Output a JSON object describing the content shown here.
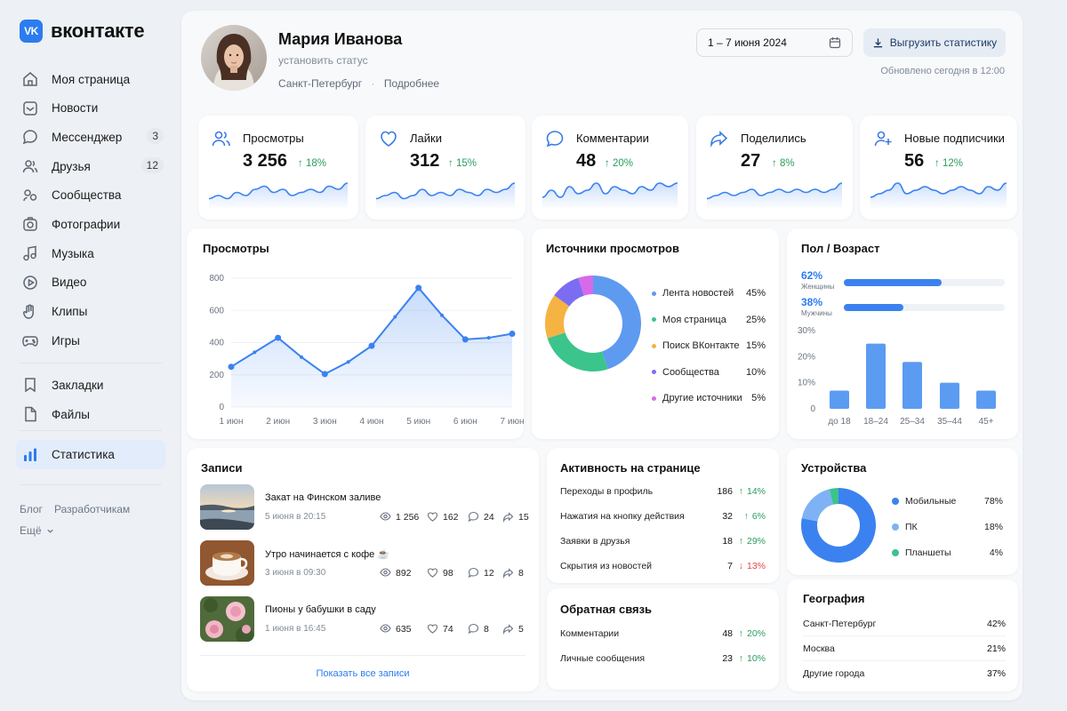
{
  "brand": {
    "logo_mark": "VK",
    "name": "вконтакте"
  },
  "sidebar": {
    "items": [
      {
        "label": "Моя страница",
        "icon": "home-icon"
      },
      {
        "label": "Новости",
        "icon": "news-icon"
      },
      {
        "label": "Мессенджер",
        "icon": "chat-icon",
        "badge": "3"
      },
      {
        "label": "Друзья",
        "icon": "friends-icon",
        "badge": "12"
      },
      {
        "label": "Сообщества",
        "icon": "communities-icon"
      },
      {
        "label": "Фотографии",
        "icon": "camera-icon"
      },
      {
        "label": "Музыка",
        "icon": "music-icon"
      },
      {
        "label": "Видео",
        "icon": "video-icon"
      },
      {
        "label": "Клипы",
        "icon": "clips-icon"
      },
      {
        "label": "Игры",
        "icon": "gamepad-icon"
      }
    ],
    "secondary": [
      {
        "label": "Закладки",
        "icon": "bookmark-icon"
      },
      {
        "label": "Файлы",
        "icon": "file-icon"
      }
    ],
    "active": {
      "label": "Статистика",
      "icon": "stats-icon"
    },
    "footer": {
      "blog": "Блог",
      "dev": "Разработчикам",
      "more": "Ещё"
    }
  },
  "profile": {
    "name": "Мария Иванова",
    "status": "установить статус",
    "city": "Санкт-Петербург",
    "dot": "·",
    "more": "Подробнее"
  },
  "toolbar": {
    "date_range": "1 – 7 июня 2024",
    "export_label": "Выгрузить статистику",
    "updated": "Обновлено сегодня в 12:00"
  },
  "metrics": [
    {
      "label": "Просмотры",
      "value": "3 256",
      "delta": "18%",
      "icon": "users-icon",
      "spark": [
        3,
        4,
        3,
        5,
        4,
        6,
        7,
        5,
        6,
        4,
        5,
        6,
        5,
        7,
        6,
        8
      ]
    },
    {
      "label": "Лайки",
      "value": "312",
      "delta": "15%",
      "icon": "heart-icon",
      "spark": [
        3,
        4,
        5,
        3,
        4,
        6,
        4,
        5,
        4,
        6,
        5,
        4,
        6,
        5,
        6,
        8
      ]
    },
    {
      "label": "Комментарии",
      "value": "48",
      "delta": "20%",
      "icon": "comment-icon",
      "spark": [
        3,
        5,
        3,
        6,
        4,
        5,
        7,
        4,
        6,
        5,
        4,
        6,
        5,
        7,
        6,
        7
      ]
    },
    {
      "label": "Поделились",
      "value": "27",
      "delta": "8%",
      "icon": "share-icon",
      "spark": [
        3,
        4,
        5,
        4,
        5,
        6,
        4,
        5,
        6,
        5,
        6,
        5,
        6,
        5,
        6,
        8
      ]
    },
    {
      "label": "Новые подписчики",
      "value": "56",
      "delta": "12%",
      "icon": "user-plus-icon",
      "spark": [
        3,
        4,
        5,
        7,
        4,
        5,
        6,
        5,
        4,
        5,
        6,
        5,
        4,
        6,
        5,
        7
      ]
    }
  ],
  "arrow_up": "↑",
  "arrow_down": "↓",
  "views_chart": {
    "title": "Просмотры"
  },
  "sources": {
    "title": "Источники просмотров",
    "items": [
      {
        "label": "Лента новостей",
        "pct": "45%",
        "value": 45,
        "color": "#5e9af0"
      },
      {
        "label": "Моя страница",
        "pct": "25%",
        "value": 25,
        "color": "#3bc48c"
      },
      {
        "label": "Поиск ВКонтакте",
        "pct": "15%",
        "value": 15,
        "color": "#f5b342"
      },
      {
        "label": "Сообщества",
        "pct": "10%",
        "value": 10,
        "color": "#7b6df2"
      },
      {
        "label": "Другие источники",
        "pct": "5%",
        "value": 5,
        "color": "#d76ae8"
      }
    ]
  },
  "demographics": {
    "title": "Пол / Возраст",
    "female_pct": "62%",
    "female_label": "Женщины",
    "female_value": 0.62,
    "male_pct": "38%",
    "male_label": "Мужчины",
    "male_value": 0.38
  },
  "chart_data": [
    {
      "type": "area",
      "title": "Просмотры",
      "categories": [
        "1 июн",
        "2 июн",
        "3 июн",
        "4 июн",
        "5 июн",
        "6 июн",
        "7 июн"
      ],
      "x": [
        1,
        1.5,
        2,
        2.5,
        3,
        3.5,
        4,
        4.5,
        5,
        5.5,
        6,
        6.5,
        7
      ],
      "values": [
        250,
        340,
        430,
        310,
        205,
        280,
        380,
        560,
        740,
        570,
        420,
        430,
        455
      ],
      "ylim": [
        0,
        800
      ],
      "yticks": [
        "0",
        "200",
        "400",
        "600",
        "800"
      ],
      "grid": "horizontal"
    },
    {
      "type": "bar",
      "title": "Пол / Возраст",
      "categories": [
        "до 18",
        "18–24",
        "25–34",
        "35–44",
        "45+"
      ],
      "values": [
        7,
        25,
        18,
        10,
        7
      ],
      "ylim": [
        0,
        30
      ],
      "yticks": [
        "0",
        "10%",
        "20%",
        "30%"
      ]
    }
  ],
  "posts": {
    "title": "Записи",
    "items": [
      {
        "title": "Закат на Финском заливе",
        "date": "5 июня в 20:15",
        "views": "1 256",
        "likes": "162",
        "comments": "24",
        "shares": "15"
      },
      {
        "title": "Утро начинается с кофе ☕",
        "date": "3 июня в 09:30",
        "views": "892",
        "likes": "98",
        "comments": "12",
        "shares": "8"
      },
      {
        "title": "Пионы у бабушки в саду",
        "date": "1 июня в 16:45",
        "views": "635",
        "likes": "74",
        "comments": "8",
        "shares": "5"
      }
    ],
    "show_all": "Показать все записи"
  },
  "activity": {
    "title": "Активность на странице",
    "rows": [
      {
        "label": "Переходы в профиль",
        "value": "186",
        "delta": "14%",
        "dir": "up"
      },
      {
        "label": "Нажатия на кнопку действия",
        "value": "32",
        "delta": "6%",
        "dir": "up"
      },
      {
        "label": "Заявки в друзья",
        "value": "18",
        "delta": "29%",
        "dir": "up"
      },
      {
        "label": "Скрытия из новостей",
        "value": "7",
        "delta": "13%",
        "dir": "down"
      }
    ]
  },
  "feedback": {
    "title": "Обратная связь",
    "rows": [
      {
        "label": "Комментарии",
        "value": "48",
        "delta": "20%",
        "dir": "up"
      },
      {
        "label": "Личные сообщения",
        "value": "23",
        "delta": "10%",
        "dir": "up"
      }
    ]
  },
  "devices": {
    "title": "Устройства",
    "items": [
      {
        "label": "Мобильные",
        "pct": "78%",
        "value": 78,
        "color": "#3b82f0"
      },
      {
        "label": "ПК",
        "pct": "18%",
        "value": 18,
        "color": "#7fb2f5"
      },
      {
        "label": "Планшеты",
        "pct": "4%",
        "value": 4,
        "color": "#3bc48c"
      }
    ]
  },
  "geography": {
    "title": "География",
    "rows": [
      {
        "label": "Санкт-Петербург",
        "pct": "42%"
      },
      {
        "label": "Москва",
        "pct": "21%"
      },
      {
        "label": "Другие города",
        "pct": "37%"
      }
    ]
  },
  "colors": {
    "accent": "#2b7cf0",
    "positive": "#2a9d5c",
    "negative": "#e64646"
  }
}
